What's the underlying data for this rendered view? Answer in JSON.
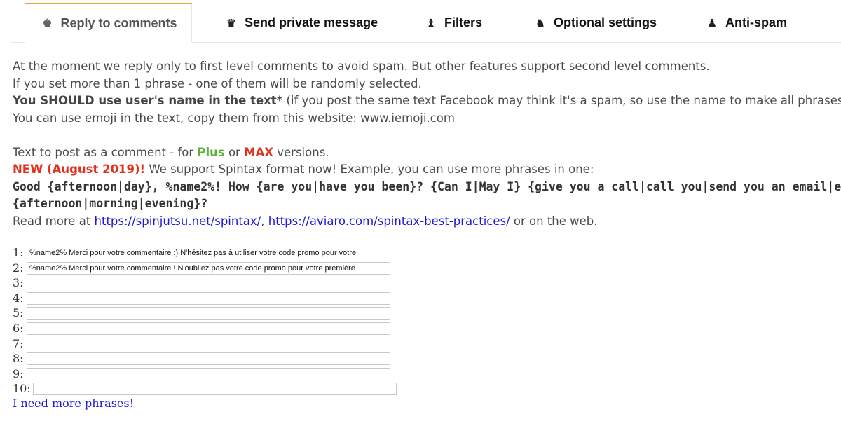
{
  "tabs": [
    {
      "label": "Reply to comments",
      "icon": "chess-king-icon"
    },
    {
      "label": "Send private message",
      "icon": "chess-queen-icon"
    },
    {
      "label": "Filters",
      "icon": "chess-bishop-icon"
    },
    {
      "label": "Optional settings",
      "icon": "chess-knight-icon"
    },
    {
      "label": "Anti-spam",
      "icon": "chess-pawn-icon"
    }
  ],
  "intro": {
    "line1": "At the moment we reply only to first level comments to avoid spam. But other features support second level comments.",
    "line2": "If you set more than 1 phrase - one of them will be randomly selected.",
    "line3_bold": "You SHOULD use user's name in the text*",
    "line3_rest": " (if you post the same text Facebook may think it's a spam, so use the name to make all phrases unique).",
    "line4": "You can use emoji in the text, copy them from this website: www.iemoji.com"
  },
  "versions": {
    "prefix": "Text to post as a comment - for ",
    "plus": "Plus",
    "or": " or ",
    "max": "MAX",
    "suffix": " versions."
  },
  "spintax": {
    "new_label": "NEW (August 2019)!",
    "new_text": " We support Spintax format now! Example, you can use more phrases in one:",
    "example_line1": "Good {afternoon|day}, %name2%! How {are you|have you been}? {Can I|May I} {give you a call|call you|send you an email|email you} this",
    "example_line2": "{afternoon|morning|evening}?",
    "read_more_prefix": "Read more at ",
    "link1": "https://spinjutsu.net/spintax/",
    "comma": ", ",
    "link2": "https://aviaro.com/spintax-best-practices/",
    "read_more_suffix": " or on the web."
  },
  "phrases": [
    {
      "label": "1:",
      "value": "%name2% Merci pour votre commentaire :) N'hésitez pas à utiliser votre code promo pour votre"
    },
    {
      "label": "2:",
      "value": "%name2% Merci pour votre commentaire ! N'oubliez pas votre code promo pour votre première"
    },
    {
      "label": "3:",
      "value": ""
    },
    {
      "label": "4:",
      "value": ""
    },
    {
      "label": "5:",
      "value": ""
    },
    {
      "label": "6:",
      "value": ""
    },
    {
      "label": "7:",
      "value": ""
    },
    {
      "label": "8:",
      "value": ""
    },
    {
      "label": "9:",
      "value": ""
    },
    {
      "label": "10:",
      "value": ""
    }
  ],
  "more_link": "I need more phrases!",
  "colors": {
    "accent": "#f0a030",
    "plus": "#5bb33a",
    "max": "#e0321e",
    "link": "#1a1ad6"
  }
}
